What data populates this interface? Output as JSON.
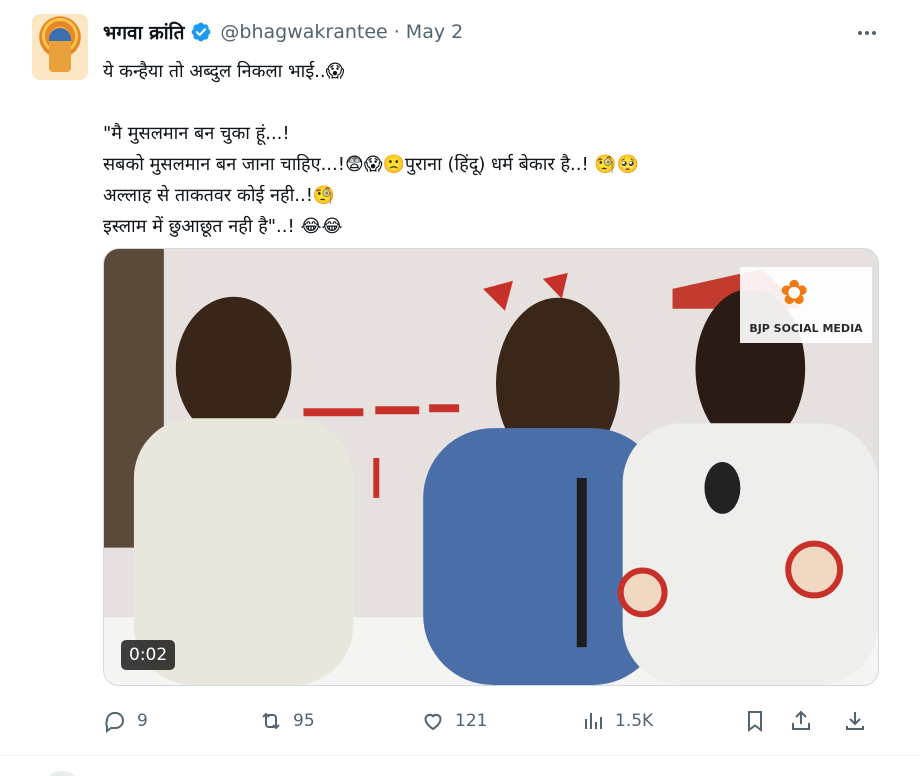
{
  "tweet": {
    "display_name": "भगवा क्रांति",
    "handle": "@bhagwakrantee",
    "separator": "·",
    "date": "May 2",
    "text": "ये कन्हैया तो अब्दुल निकला भाई..😱\n\n\"मै मुसलमान बन चुका हूं...!\nसबको मुसलमान बन जाना चाहिए...!😨😱🙁पुराना (हिंदू) धर्म बेकार है..! 🧐🥺\nअल्लाह से ताकतवर कोई नही..!🧐\nइस्लाम में छुआछूत नही है\"..! 😂😂",
    "media": {
      "duration": "0:02",
      "watermark_text": "BJP SOCIAL MEDIA"
    },
    "actions": {
      "replies": "9",
      "retweets": "95",
      "likes": "121",
      "views": "1.5K"
    }
  },
  "colors": {
    "verified_badge": "#1d9bf0",
    "secondary_text": "#536471",
    "primary_text": "#0f1419"
  },
  "icons": {
    "verified": "verified-badge-icon",
    "more": "more-icon",
    "reply": "reply-icon",
    "retweet": "retweet-icon",
    "like": "heart-icon",
    "views": "views-icon",
    "bookmark": "bookmark-icon",
    "share": "share-icon",
    "download": "download-icon"
  }
}
